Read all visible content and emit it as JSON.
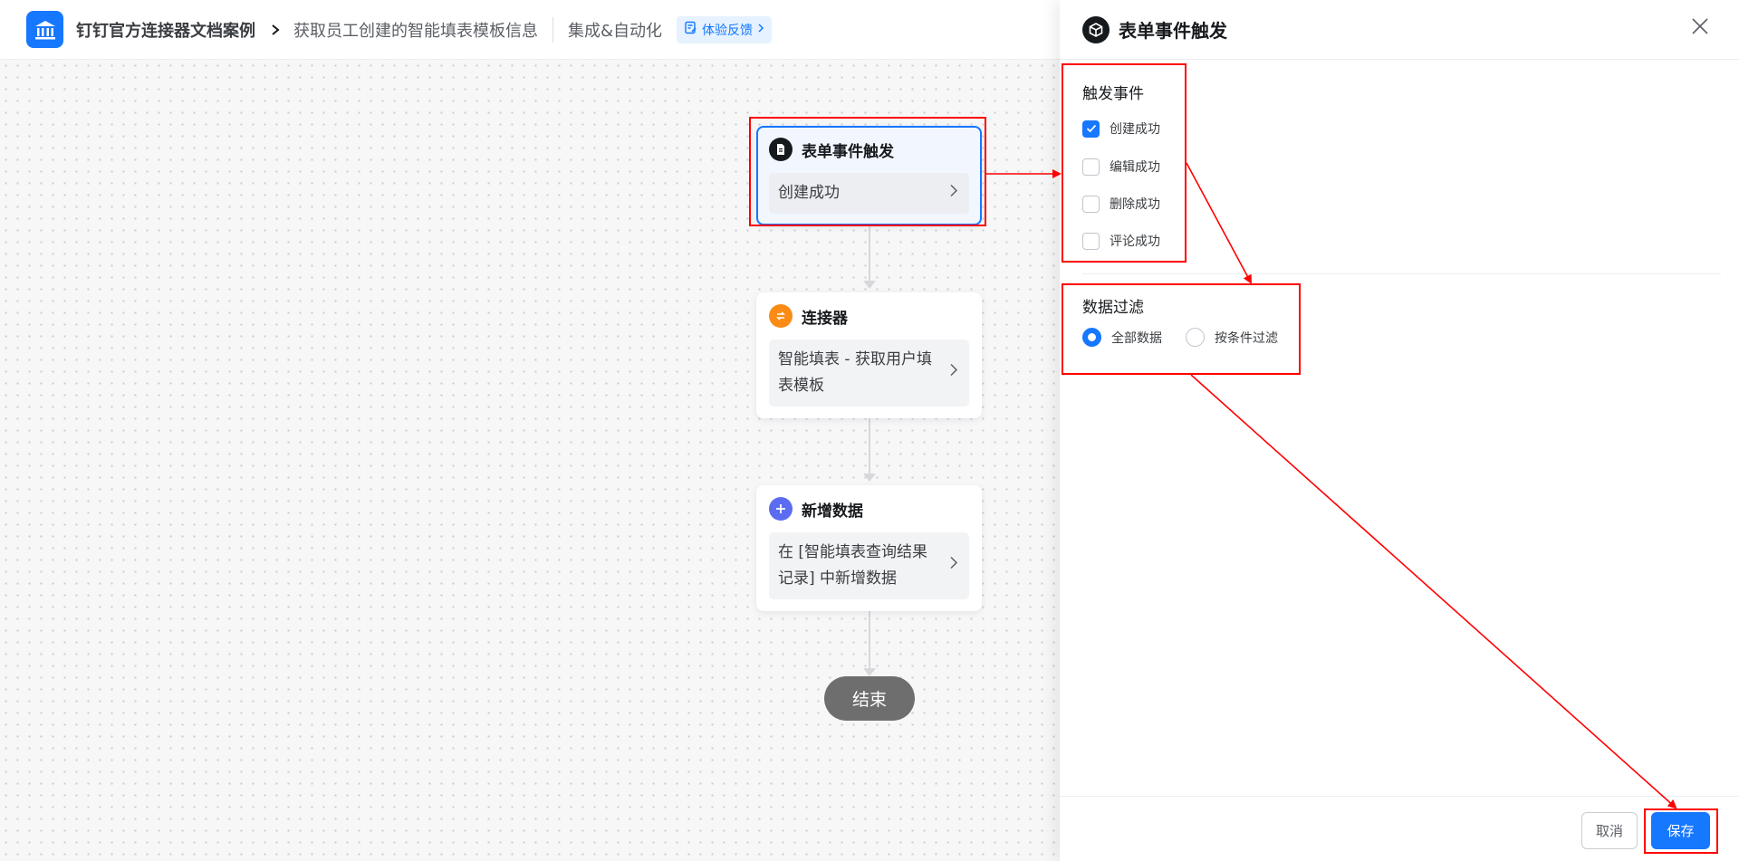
{
  "header": {
    "app_name": "钉钉官方连接器文档案例",
    "page_name": "获取员工创建的智能填表模板信息",
    "section_name": "集成&自动化",
    "feedback_label": "体验反馈"
  },
  "flow": {
    "trigger": {
      "title": "表单事件触发",
      "body": "创建成功"
    },
    "connector": {
      "title": "连接器",
      "body": "智能填表 - 获取用户填表模板"
    },
    "add_data": {
      "title": "新增数据",
      "body": "在 [智能填表查询结果记录] 中新增数据"
    },
    "end_label": "结束"
  },
  "panel": {
    "title": "表单事件触发",
    "trigger_section_label": "触发事件",
    "trigger_options": [
      {
        "label": "创建成功",
        "checked": true
      },
      {
        "label": "编辑成功",
        "checked": false
      },
      {
        "label": "删除成功",
        "checked": false
      },
      {
        "label": "评论成功",
        "checked": false
      }
    ],
    "filter_section_label": "数据过滤",
    "filter_options": [
      {
        "label": "全部数据",
        "selected": true
      },
      {
        "label": "按条件过滤",
        "selected": false
      }
    ],
    "cancel_label": "取消",
    "save_label": "保存"
  },
  "colors": {
    "accent": "#1677ff",
    "connector_icon": "#fa8c16",
    "add_icon": "#5b6cf0",
    "end_node": "#6e6e6e",
    "annotation": "#ff0000"
  }
}
